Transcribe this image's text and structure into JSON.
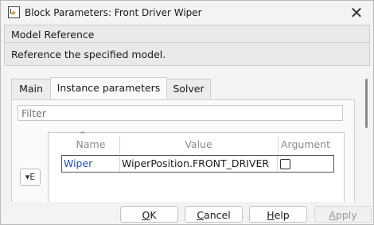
{
  "window": {
    "title": "Block Parameters: Front Driver Wiper",
    "close_glyph": "✕"
  },
  "group": {
    "title": "Model Reference",
    "description": "Reference the specified model."
  },
  "tabs": [
    {
      "label": "Main",
      "selected": false
    },
    {
      "label": "Instance parameters",
      "selected": true
    },
    {
      "label": "Solver",
      "selected": false
    }
  ],
  "filter": {
    "placeholder": "Filter",
    "value": ""
  },
  "table": {
    "columns": [
      "Name",
      "Value",
      "Argument"
    ],
    "rows": [
      {
        "name": "Wiper",
        "value": "WiperPosition.FRONT_DRIVER",
        "argument_checked": false
      }
    ]
  },
  "side_button": {
    "glyph": "▾E"
  },
  "buttons": {
    "ok": {
      "accel": "O",
      "rest": "K"
    },
    "cancel": {
      "accel": "C",
      "rest": "ancel"
    },
    "help": {
      "accel": "H",
      "rest": "elp"
    },
    "apply": {
      "accel": "A",
      "rest": "pply",
      "enabled": false
    }
  }
}
